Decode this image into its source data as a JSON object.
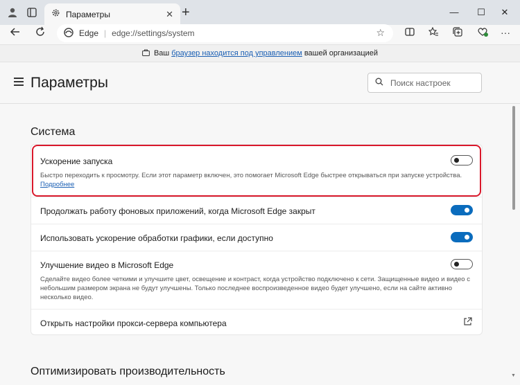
{
  "window": {
    "tab_title": "Параметры",
    "tab_close_icon": "close-icon",
    "new_tab_icon": "plus-icon"
  },
  "navbar": {
    "edge_label": "Edge",
    "url": "edge://settings/system"
  },
  "banner": {
    "prefix": "Ваш",
    "link": "браузер находится под управлением",
    "suffix": "вашей организацией"
  },
  "header": {
    "title": "Параметры",
    "search_placeholder": "Поиск настроек"
  },
  "system": {
    "title": "Система",
    "startup_boost": {
      "label": "Ускорение запуска",
      "description": "Быстро переходить к просмотру. Если этот параметр включен, это помогает Microsoft Edge быстрее открываться при запуске устройства.",
      "link": "Подробнее",
      "enabled": false
    },
    "background_apps": {
      "label": "Продолжать работу фоновых приложений, когда Microsoft Edge закрыт",
      "enabled": true
    },
    "hardware_accel": {
      "label": "Использовать ускорение обработки графики, если доступно",
      "enabled": true
    },
    "video_enhance": {
      "label": "Улучшение видео в Microsoft Edge",
      "description": "Сделайте видео более четкими и улучшите цвет, освещение и контраст, когда устройство подключено к сети. Защищенные видео и видео с небольшим размером экрана не будут улучшены. Только последнее воспроизведенное видео будет улучшено, если на сайте активно несколько видео.",
      "enabled": false
    },
    "proxy": {
      "label": "Открыть настройки прокси-сервера компьютера"
    }
  },
  "performance": {
    "title": "Оптимизировать производительность"
  },
  "colors": {
    "accent": "#0b6cbd",
    "highlight": "#d9182b"
  }
}
